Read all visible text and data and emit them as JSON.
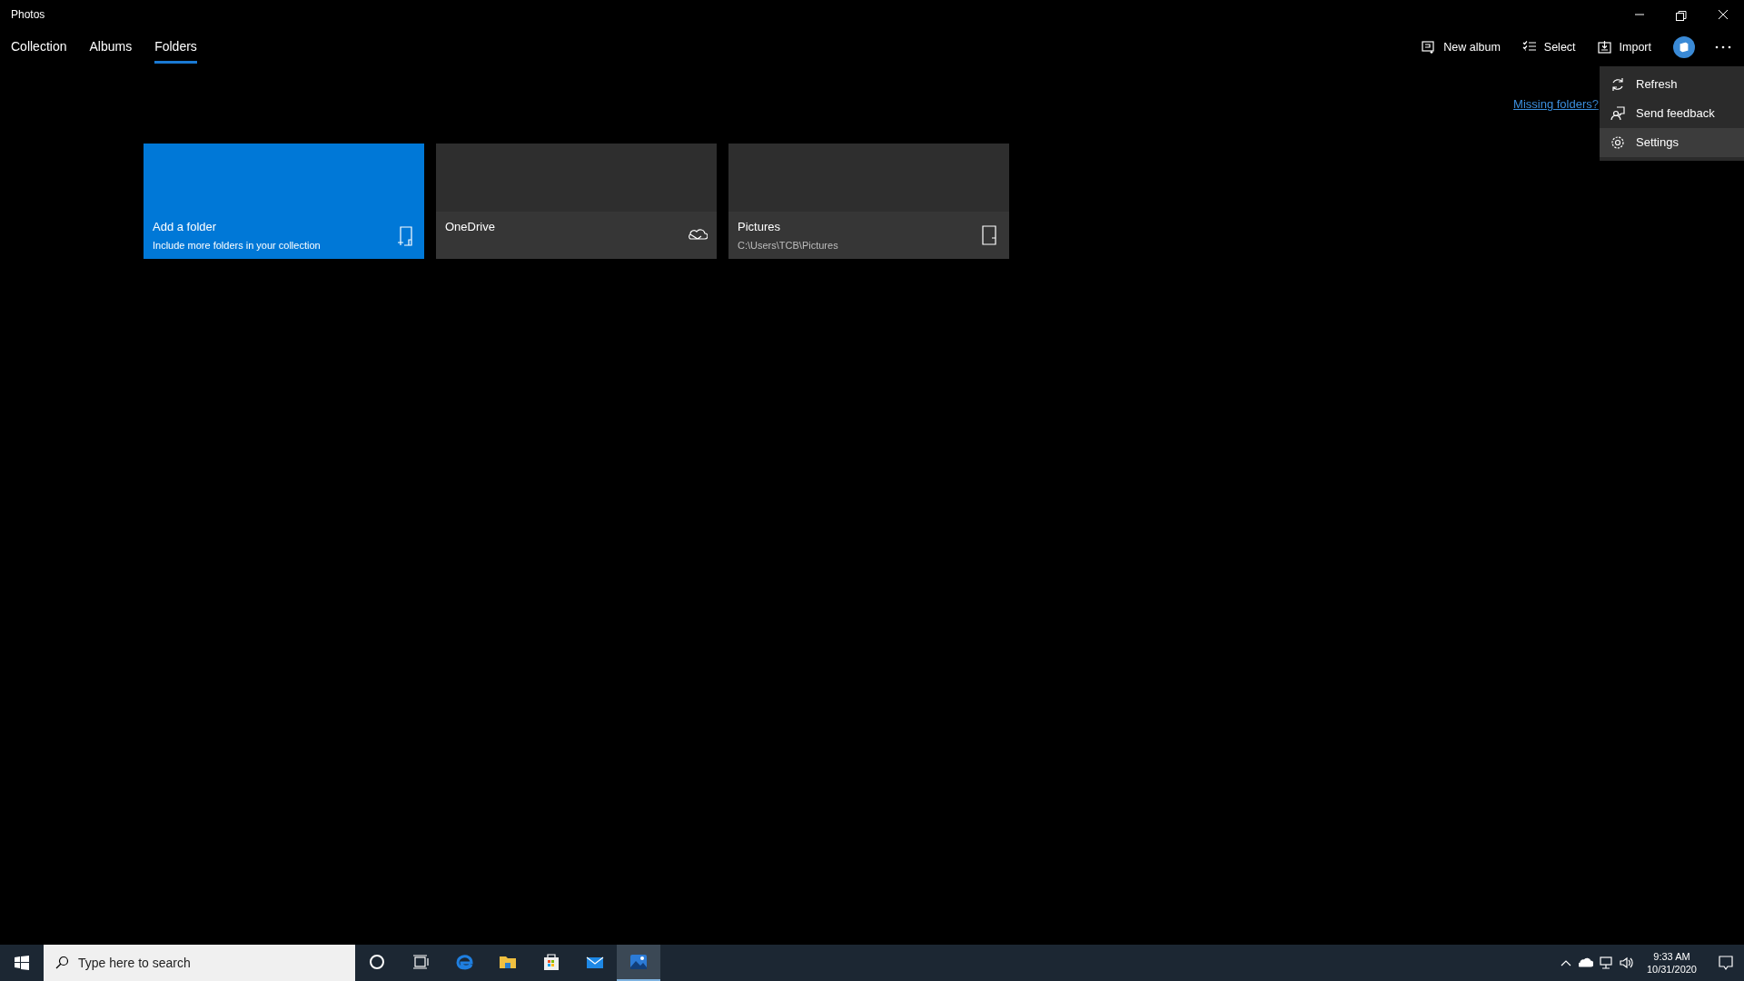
{
  "window": {
    "title": "Photos"
  },
  "tabs": [
    {
      "label": "Collection",
      "selected": false
    },
    {
      "label": "Albums",
      "selected": false
    },
    {
      "label": "Folders",
      "selected": true
    }
  ],
  "toolbar": [
    {
      "kind": "new-album",
      "label": "New album"
    },
    {
      "kind": "select",
      "label": "Select"
    },
    {
      "kind": "import",
      "label": "Import"
    }
  ],
  "more_menu": {
    "items": [
      {
        "kind": "refresh",
        "label": "Refresh",
        "highlighted": false
      },
      {
        "kind": "feedback",
        "label": "Send feedback",
        "highlighted": false
      },
      {
        "kind": "settings",
        "label": "Settings",
        "highlighted": true
      }
    ]
  },
  "missing_folders_link": "Missing folders?",
  "tiles": [
    {
      "kind": "add",
      "title": "Add a folder",
      "subtitle": "Include more folders in your collection"
    },
    {
      "kind": "onedrive",
      "title": "OneDrive"
    },
    {
      "kind": "folder",
      "title": "Pictures",
      "subtitle": "C:\\Users\\TCB\\Pictures"
    }
  ],
  "taskbar": {
    "search": {
      "placeholder": "Type here to search"
    },
    "apps": [
      {
        "kind": "cortana",
        "active": false
      },
      {
        "kind": "taskview",
        "active": false
      },
      {
        "kind": "edge",
        "active": false
      },
      {
        "kind": "explorer",
        "active": false
      },
      {
        "kind": "store",
        "active": false
      },
      {
        "kind": "mail",
        "active": false
      },
      {
        "kind": "photos",
        "active": true
      }
    ],
    "time": "9:33 AM",
    "date": "10/31/2020"
  }
}
